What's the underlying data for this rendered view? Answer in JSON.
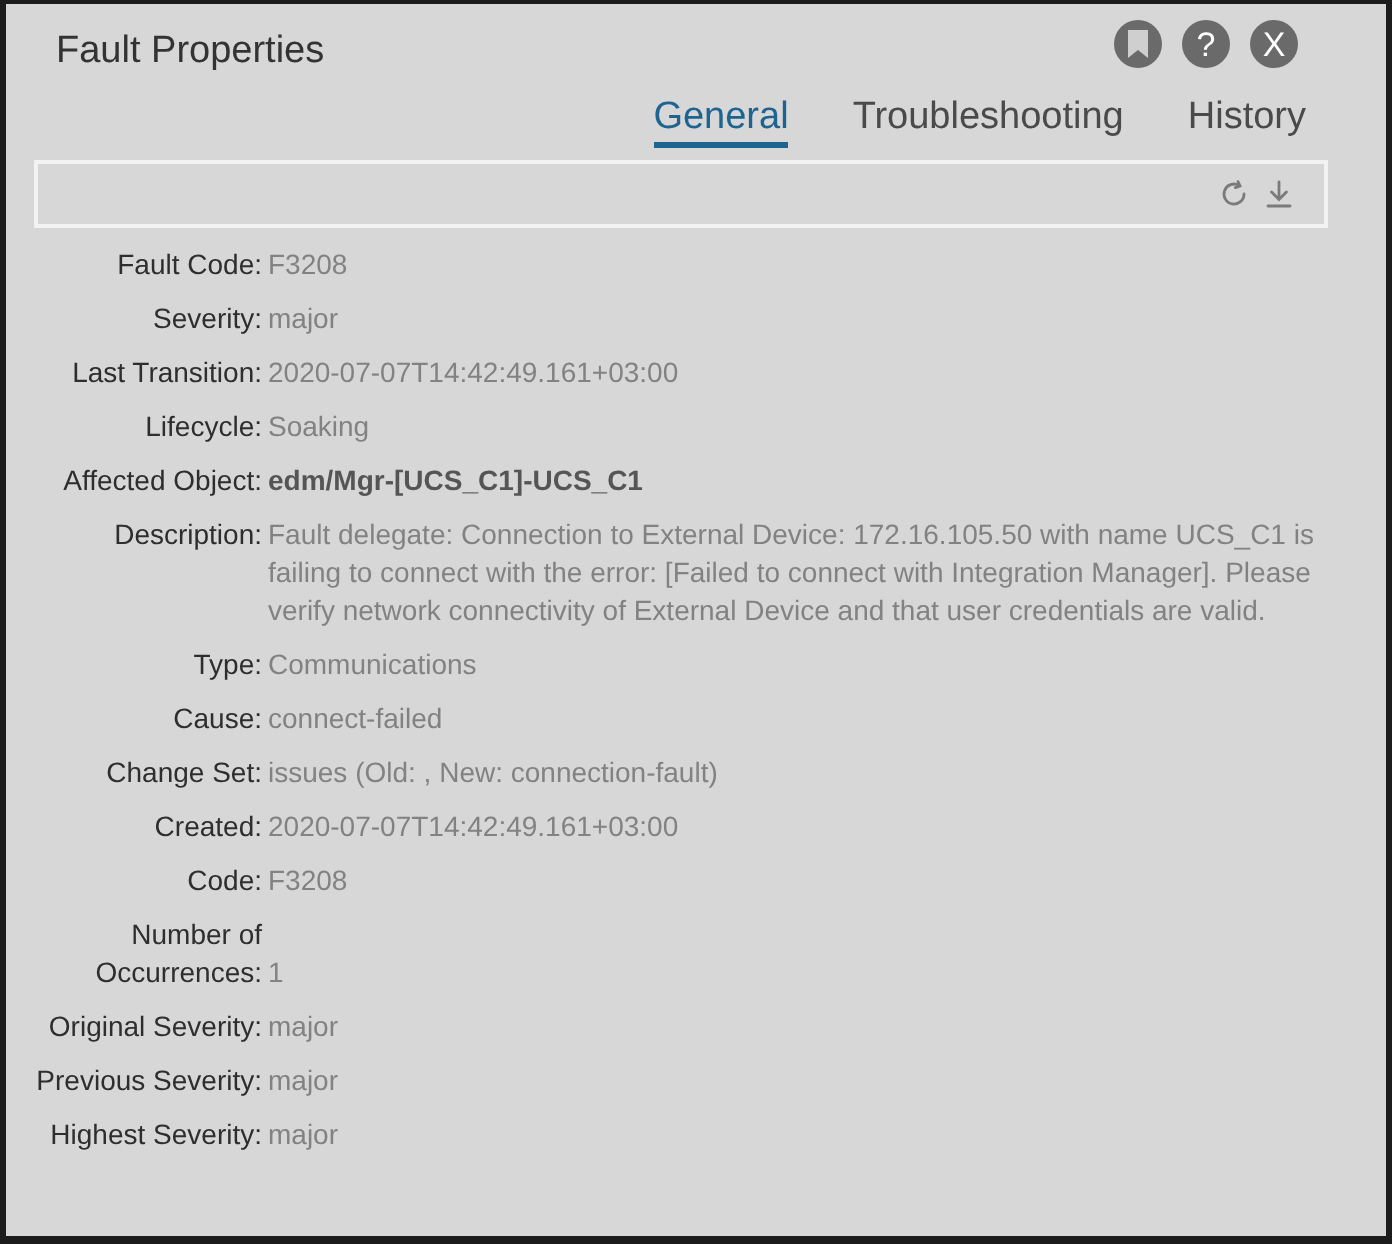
{
  "window": {
    "title": "Fault Properties"
  },
  "header_buttons": [
    {
      "kind": "bookmark"
    },
    {
      "kind": "text",
      "label": "?"
    },
    {
      "kind": "text",
      "label": "X"
    }
  ],
  "tabs": [
    {
      "label": "General",
      "selected": true
    },
    {
      "label": "Troubleshooting",
      "selected": false
    },
    {
      "label": "History",
      "selected": false
    }
  ],
  "toolbar": {
    "buttons": [
      {
        "kind": "refresh"
      },
      {
        "kind": "download"
      }
    ]
  },
  "fields": [
    {
      "label": "Fault Code:",
      "value": "F3208",
      "bold": false
    },
    {
      "label": "Severity:",
      "value": "major",
      "bold": false
    },
    {
      "label": "Last Transition:",
      "value": "2020-07-07T14:42:49.161+03:00",
      "bold": false
    },
    {
      "label": "Lifecycle:",
      "value": "Soaking",
      "bold": false
    },
    {
      "label": "Affected Object:",
      "value": "edm/Mgr-[UCS_C1]-UCS_C1",
      "bold": true
    },
    {
      "label": "Description:",
      "value": "Fault delegate: Connection to External Device: 172.16.105.50 with name UCS_C1 is failing to connect with the error: [Failed to connect with Integration Manager]. Please verify network connectivity of External Device and that user credentials are valid.",
      "bold": false
    },
    {
      "label": "Type:",
      "value": "Communications",
      "bold": false
    },
    {
      "label": "Cause:",
      "value": "connect-failed",
      "bold": false
    },
    {
      "label": "Change Set:",
      "value": "issues (Old: , New: connection-fault)",
      "bold": false
    },
    {
      "label": "Created:",
      "value": "2020-07-07T14:42:49.161+03:00",
      "bold": false
    },
    {
      "label": "Code:",
      "value": "F3208",
      "bold": false
    },
    {
      "label": "Number of Occurrences:",
      "value": "1",
      "bold": false
    },
    {
      "label": "Original Severity:",
      "value": "major",
      "bold": false
    },
    {
      "label": "Previous Severity:",
      "value": "major",
      "bold": false
    },
    {
      "label": "Highest Severity:",
      "value": "major",
      "bold": false
    }
  ]
}
